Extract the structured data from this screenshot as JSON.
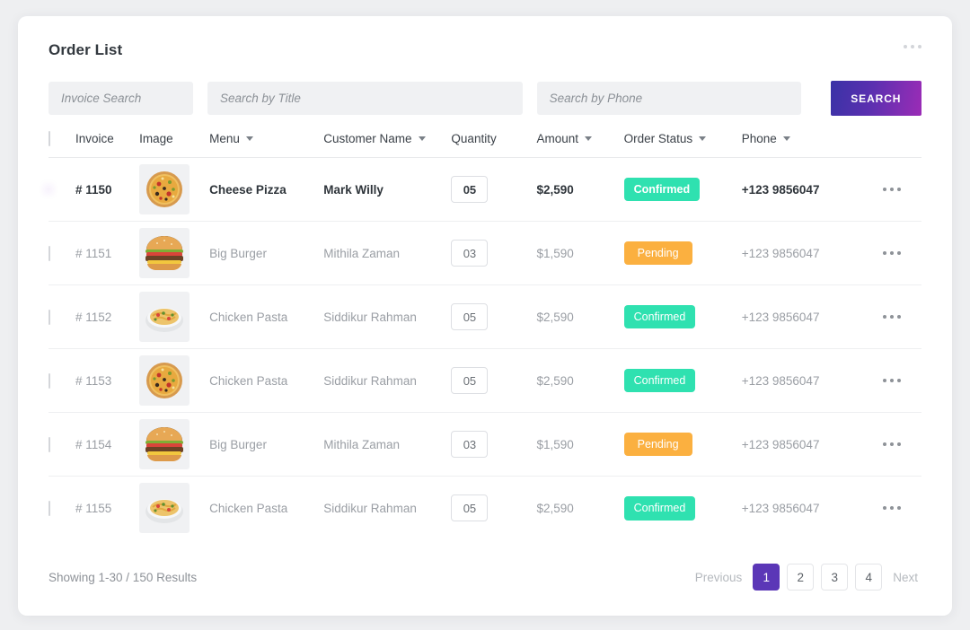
{
  "card": {
    "title": "Order List",
    "overflow_icon": "more-horizontal-icon"
  },
  "search": {
    "invoice_placeholder": "Invoice Search",
    "title_placeholder": "Search by Title",
    "phone_placeholder": "Search by Phone",
    "button_label": "SEARCH",
    "invoice_value": "",
    "title_value": "",
    "phone_value": ""
  },
  "table": {
    "headers": [
      {
        "label": "Invoice",
        "sortable": false
      },
      {
        "label": "Image",
        "sortable": false
      },
      {
        "label": "Menu",
        "sortable": true
      },
      {
        "label": "Customer Name",
        "sortable": true
      },
      {
        "label": "Quantity",
        "sortable": false
      },
      {
        "label": "Amount",
        "sortable": true
      },
      {
        "label": "Order Status",
        "sortable": true
      },
      {
        "label": "Phone",
        "sortable": true
      }
    ],
    "rows": [
      {
        "selected": true,
        "invoice": "# 1150",
        "image": "pizza",
        "menu": "Cheese Pizza",
        "customer": "Mark Willy",
        "quantity": "05",
        "amount": "$2,590",
        "status": "Confirmed",
        "status_kind": "confirmed",
        "phone": "+123 9856047"
      },
      {
        "selected": false,
        "invoice": "# 1151",
        "image": "burger",
        "menu": "Big Burger",
        "customer": "Mithila Zaman",
        "quantity": "03",
        "amount": "$1,590",
        "status": "Pending",
        "status_kind": "pending",
        "phone": "+123 9856047"
      },
      {
        "selected": false,
        "invoice": "# 1152",
        "image": "pasta-bowl",
        "menu": "Chicken Pasta",
        "customer": "Siddikur Rahman",
        "quantity": "05",
        "amount": "$2,590",
        "status": "Confirmed",
        "status_kind": "confirmed",
        "phone": "+123 9856047"
      },
      {
        "selected": false,
        "invoice": "# 1153",
        "image": "pizza",
        "menu": "Chicken Pasta",
        "customer": "Siddikur Rahman",
        "quantity": "05",
        "amount": "$2,590",
        "status": "Confirmed",
        "status_kind": "confirmed",
        "phone": "+123 9856047"
      },
      {
        "selected": false,
        "invoice": "# 1154",
        "image": "burger",
        "menu": "Big Burger",
        "customer": "Mithila Zaman",
        "quantity": "03",
        "amount": "$1,590",
        "status": "Pending",
        "status_kind": "pending",
        "phone": "+123 9856047"
      },
      {
        "selected": false,
        "invoice": "# 1155",
        "image": "pasta-bowl",
        "menu": "Chicken Pasta",
        "customer": "Siddikur Rahman",
        "quantity": "05",
        "amount": "$2,590",
        "status": "Confirmed",
        "status_kind": "confirmed",
        "phone": "+123 9856047"
      }
    ]
  },
  "footer": {
    "showing": "Showing 1-30 / 150 Results",
    "previous_label": "Previous",
    "next_label": "Next",
    "pages": [
      "1",
      "2",
      "3",
      "4"
    ],
    "active_page": "1"
  },
  "colors": {
    "accent_purple": "#5b37b7",
    "search_gradient_from": "#3a32a6",
    "search_gradient_to": "#9b2cb6",
    "confirmed": "#2fe1b0",
    "pending": "#fbb040",
    "page_bg": "#eeeff1"
  }
}
